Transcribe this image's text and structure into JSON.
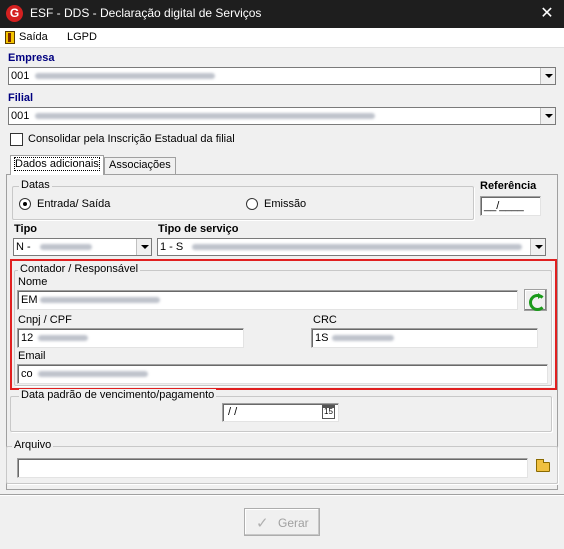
{
  "window": {
    "title": "ESF - DDS - Declaração digital de Serviços",
    "icon_letter": "G",
    "close_glyph": "✕"
  },
  "menu": {
    "items": [
      "Saída",
      "LGPD"
    ]
  },
  "empresa": {
    "label": "Empresa",
    "value": "001"
  },
  "filial": {
    "label": "Filial",
    "value": "001"
  },
  "consolidar": {
    "label": "Consolidar pela Inscrição Estadual da filial",
    "checked": false
  },
  "tabs": [
    {
      "label": "Dados adicionais",
      "active": true
    },
    {
      "label": "Associações",
      "active": false
    }
  ],
  "datas": {
    "title": "Datas",
    "options": [
      {
        "label": "Entrada/ Saída",
        "selected": true
      },
      {
        "label": "Emissão",
        "selected": false
      }
    ]
  },
  "referencia": {
    "label": "Referência",
    "value": "__/____"
  },
  "tipo": {
    "label": "Tipo",
    "value": "N -"
  },
  "tipo_servico": {
    "label": "Tipo de serviço",
    "value": "1 - S"
  },
  "contador": {
    "title": "Contador / Responsável",
    "nome": {
      "label": "Nome",
      "value": "EM"
    },
    "cnpj": {
      "label": "Cnpj / CPF",
      "value": "12"
    },
    "crc": {
      "label": "CRC",
      "value": "1S"
    },
    "email": {
      "label": "Email",
      "value": "co"
    }
  },
  "vencimento": {
    "title": "Data padrão de vencimento/pagamento",
    "value": " /  /",
    "calendar_glyph": "15"
  },
  "arquivo": {
    "title": "Arquivo",
    "value": ""
  },
  "gerar": {
    "label": "Gerar",
    "enabled": false,
    "icon": "check-icon"
  },
  "colors": {
    "titlebar": "#1e1e1e",
    "highlight": "#e02020",
    "label_navy": "#000080"
  }
}
